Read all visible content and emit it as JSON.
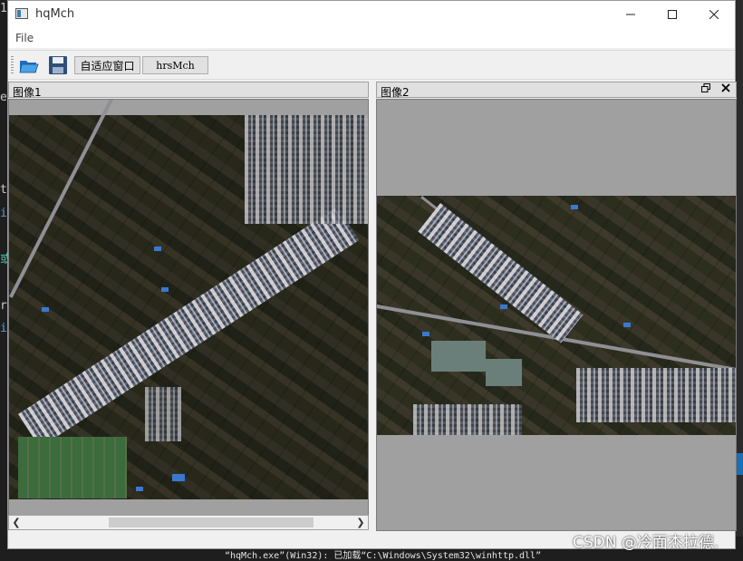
{
  "window": {
    "title": "hqMch"
  },
  "menubar": {
    "items": [
      {
        "label": "File"
      }
    ]
  },
  "toolbar": {
    "open_icon": "folder-open-icon",
    "save_icon": "floppy-disk-icon",
    "fit_label": "自适应窗口",
    "hrsmch_label": "hrsMch"
  },
  "panels": {
    "left": {
      "title": "图像1"
    },
    "right": {
      "title": "图像2",
      "float_icon": "restore-icon",
      "close_icon": "close-icon"
    }
  },
  "ide": {
    "left_glyphs": [
      "1",
      "e",
      "t",
      "i",
      "或",
      "r",
      "i"
    ],
    "bottom_text": "“hqMch.exe”(Win32): 已加载“C:\\Windows\\System32\\winhttp.dll”"
  },
  "watermark": "CSDN @冷面杰拉德."
}
